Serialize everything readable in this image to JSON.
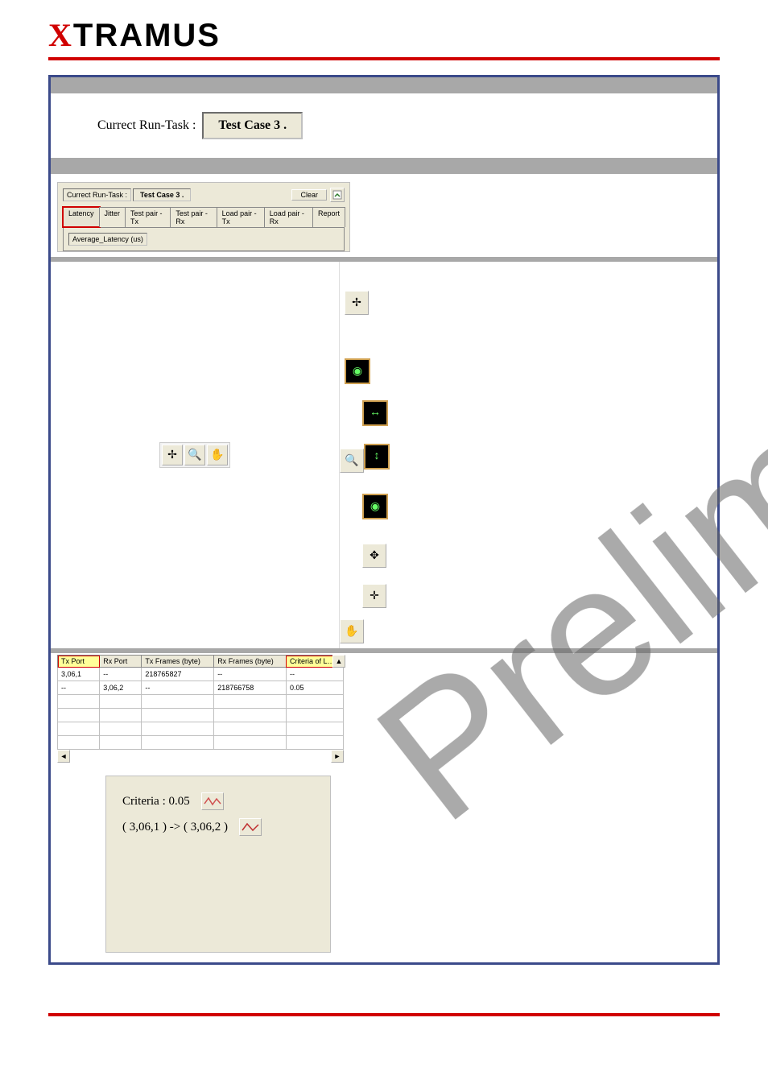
{
  "brand": {
    "x": "X",
    "rest": "TRAMUS"
  },
  "watermark": "Preliminary",
  "row1": {
    "label": "Currect Run-Task :",
    "value": "Test Case 3 ."
  },
  "panel2": {
    "label": "Currect Run-Task :",
    "value": "Test Case 3 .",
    "clear": "Clear",
    "tabs": [
      "Latency",
      "Jitter",
      "Test pair - Tx",
      "Test pair - Rx",
      "Load pair - Tx",
      "Load pair - Rx",
      "Report"
    ],
    "active_tab_index": 0,
    "sublabel": "Average_Latency (us)"
  },
  "chart_toolbar_mid": {
    "cross": "✢",
    "zoom": "🔍",
    "hand": "✋"
  },
  "right_icons": {
    "cross": "✢",
    "scope1": "◉",
    "hzoom": "↔",
    "zoom": "🔍",
    "vzoom": "↕",
    "scope2": "◉",
    "pan": "✥",
    "pan2": "✛",
    "hand": "✋"
  },
  "table": {
    "headers": [
      "Tx Port",
      "Rx Port",
      "Tx Frames (byte)",
      "Rx Frames (byte)",
      "Criteria of L…"
    ],
    "hl_col": 4,
    "rows": [
      [
        "3,06,1",
        "--",
        "218765827",
        "--",
        "--"
      ],
      [
        "--",
        "3,06,2",
        "--",
        "218766758",
        "0.05"
      ],
      [
        "",
        "",
        "",
        "",
        ""
      ],
      [
        "",
        "",
        "",
        "",
        ""
      ],
      [
        "",
        "",
        "",
        "",
        ""
      ],
      [
        "",
        "",
        "",
        "",
        ""
      ]
    ]
  },
  "criteria": {
    "line1": "Criteria : 0.05",
    "line2": "( 3,06,1 ) -> ( 3,06,2 )"
  }
}
